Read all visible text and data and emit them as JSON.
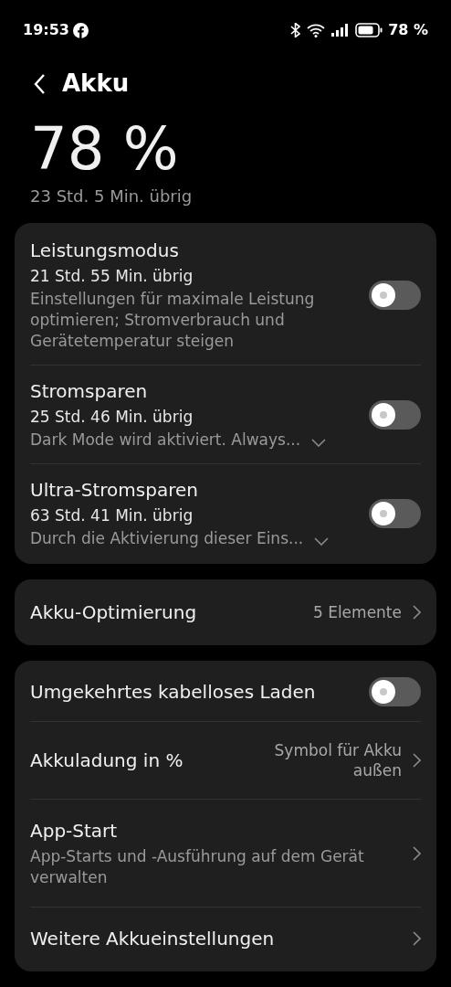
{
  "status_bar": {
    "time": "19:53",
    "battery": "78 %"
  },
  "header": {
    "title": "Akku"
  },
  "battery": {
    "percent": "78 %",
    "remaining": "23 Std. 5 Min. übrig"
  },
  "cards": [
    {
      "rows": [
        {
          "kind": "mode",
          "title": "Leistungsmodus",
          "time": "21 Std. 55 Min. übrig",
          "description": "Einstellungen für maximale Leistung optimieren; Stromverbrauch und Gerätetemperatur steigen",
          "expandable": false,
          "on": false
        },
        {
          "kind": "mode",
          "title": "Stromsparen",
          "time": "25 Std. 46 Min. übrig",
          "description": "Dark Mode wird aktiviert. Always...",
          "expandable": true,
          "on": false
        },
        {
          "kind": "mode",
          "title": "Ultra-Stromsparen",
          "time": "63 Std. 41 Min. übrig",
          "description": "Durch die Aktivierung dieser Eins...",
          "expandable": true,
          "on": false
        }
      ]
    },
    {
      "rows": [
        {
          "kind": "link",
          "title": "Akku-Optimierung",
          "value": "5 Elemente"
        }
      ]
    },
    {
      "rows": [
        {
          "kind": "toggle",
          "title": "Umgekehrtes kabelloses Laden",
          "on": false
        },
        {
          "kind": "link",
          "title": "Akkuladung in %",
          "value": "Symbol für Akku außen"
        },
        {
          "kind": "link",
          "title": "App-Start",
          "description": "App-Starts und -Ausführung auf dem Gerät verwalten"
        },
        {
          "kind": "link",
          "title": "Weitere Akkueinstellungen"
        }
      ]
    }
  ]
}
